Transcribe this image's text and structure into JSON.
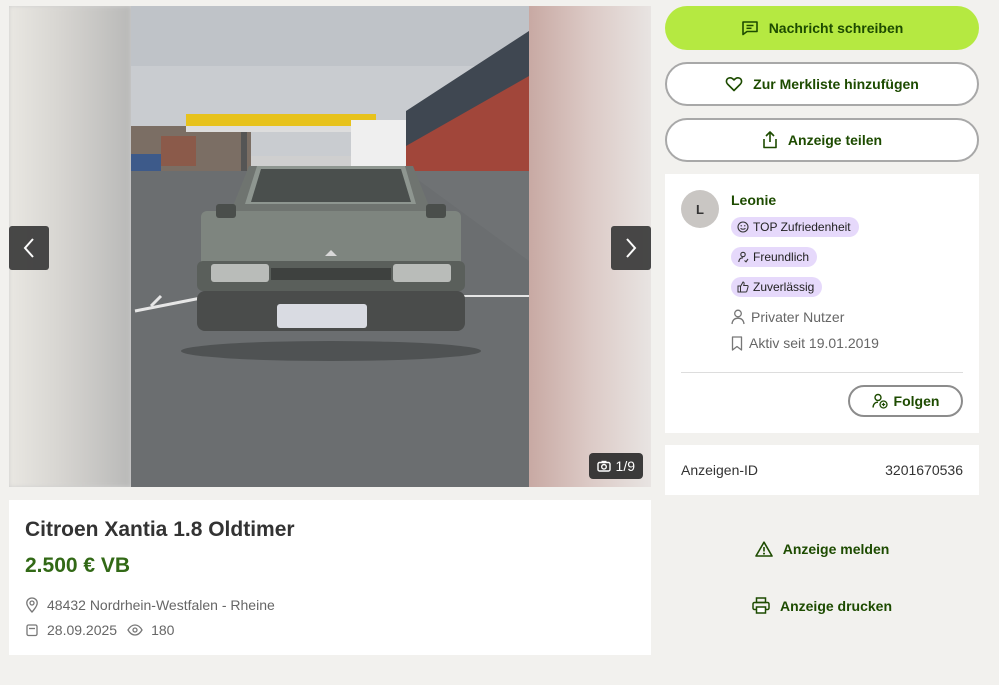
{
  "gallery": {
    "counter": "1/9"
  },
  "listing": {
    "title": "Citroen Xantia 1.8 Oldtimer",
    "price": "2.500 € VB",
    "location": "48432 Nordrhein-Westfalen - Rheine",
    "date": "28.09.2025",
    "views": "180"
  },
  "actions": {
    "message": "Nachricht schreiben",
    "watchlist": "Zur Merkliste hinzufügen",
    "share": "Anzeige teilen",
    "report": "Anzeige melden",
    "print": "Anzeige drucken"
  },
  "seller": {
    "initial": "L",
    "name": "Leonie",
    "badges": [
      "TOP Zufriedenheit",
      "Freundlich",
      "Zuverlässig"
    ],
    "type": "Privater Nutzer",
    "active_since": "Aktiv seit 19.01.2019",
    "follow_label": "Folgen"
  },
  "ad_id": {
    "label": "Anzeigen-ID",
    "value": "3201670536"
  },
  "colors": {
    "accent": "#b5e941",
    "text_green": "#1d4b00",
    "price_green": "#326916",
    "badge_bg": "#e6d9fb"
  }
}
